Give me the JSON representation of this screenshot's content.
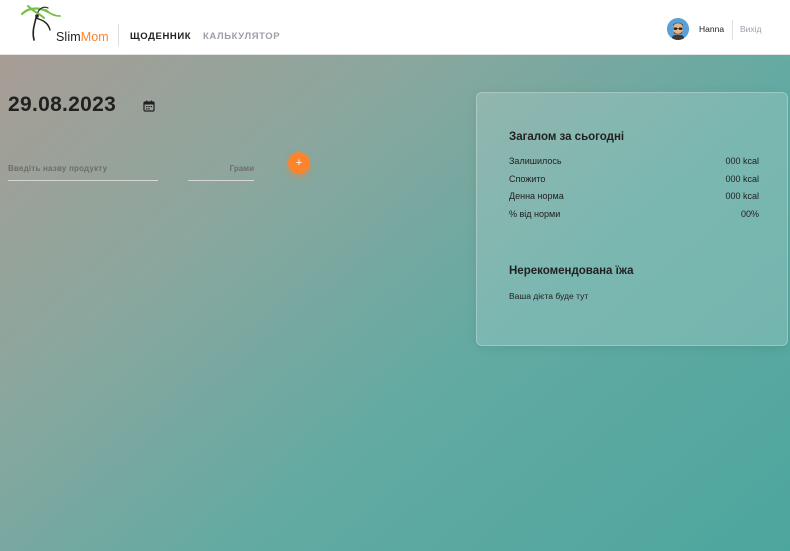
{
  "header": {
    "logo": {
      "text_main": "Slim",
      "text_accent": "Mom",
      "icon": "slim-mom-logo-icon"
    },
    "nav": {
      "diary_label": "ЩОДЕННИК",
      "calculator_label": "КАЛЬКУЛЯТОР"
    },
    "user": {
      "avatar_icon": "user-avatar-icon",
      "name": "Hanna",
      "logout_label": "Вихід"
    }
  },
  "diary": {
    "date": "29.08.2023",
    "calendar_icon": "calendar-icon",
    "product_input": {
      "placeholder": "Введіть назву продукту",
      "value": ""
    },
    "grams_input": {
      "placeholder": "Грами",
      "value": ""
    },
    "add_button_label": "+"
  },
  "summary": {
    "title": "Загалом за сьогодні",
    "rows": [
      {
        "label": "Залишилось",
        "value": "000 kcal"
      },
      {
        "label": "Спожито",
        "value": "000 kcal"
      },
      {
        "label": "Денна норма",
        "value": "000 kcal"
      },
      {
        "label": "% від норми",
        "value": "00%"
      }
    ],
    "food_title": "Нерекомендована їжа",
    "food_text": "Ваша дієта буде тут"
  },
  "colors": {
    "accent": "#fc842d",
    "text_dark": "#212121",
    "text_muted": "#9b9faa",
    "background_start": "#a89d95",
    "background_end": "#4da69e"
  }
}
